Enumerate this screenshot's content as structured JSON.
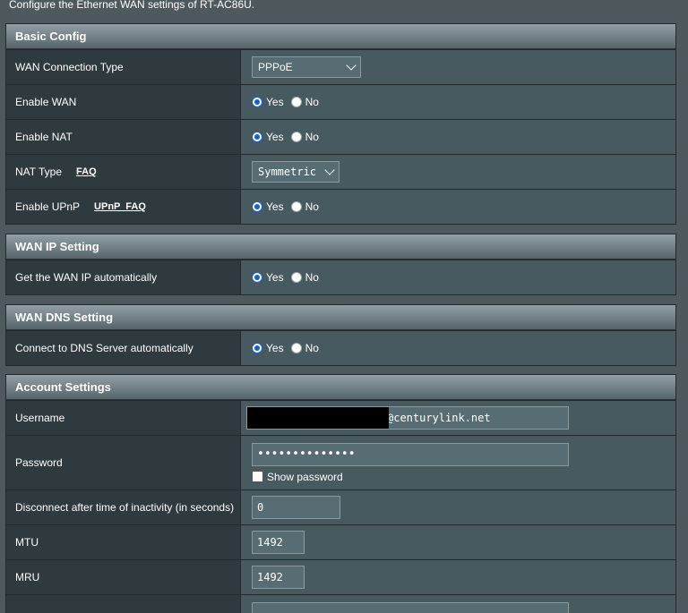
{
  "intro": "Configure the Ethernet WAN settings of RT-AC86U.",
  "basic": {
    "title": "Basic Config",
    "wan_type_label": "WAN Connection Type",
    "wan_type_value": "PPPoE",
    "enable_wan_label": "Enable WAN",
    "enable_nat_label": "Enable NAT",
    "nat_type_label": "NAT Type",
    "nat_faq": "FAQ",
    "nat_type_value": "Symmetric",
    "enable_upnp_label": "Enable UPnP",
    "upnp_faq": "UPnP  FAQ"
  },
  "radio": {
    "yes": "Yes",
    "no": "No"
  },
  "wanip": {
    "title": "WAN IP Setting",
    "auto_label": "Get the WAN IP automatically"
  },
  "wandns": {
    "title": "WAN DNS Setting",
    "auto_label": "Connect to DNS Server automatically"
  },
  "account": {
    "title": "Account Settings",
    "username_label": "Username",
    "username_value": "@centurylink.net",
    "password_label": "Password",
    "password_value": "••••••••••••••",
    "show_password_label": "Show password",
    "disconnect_label": "Disconnect after time of inactivity (in seconds)",
    "disconnect_value": "0",
    "mtu_label": "MTU",
    "mtu_value": "1492",
    "mru_label": "MRU",
    "mru_value": "1492"
  }
}
